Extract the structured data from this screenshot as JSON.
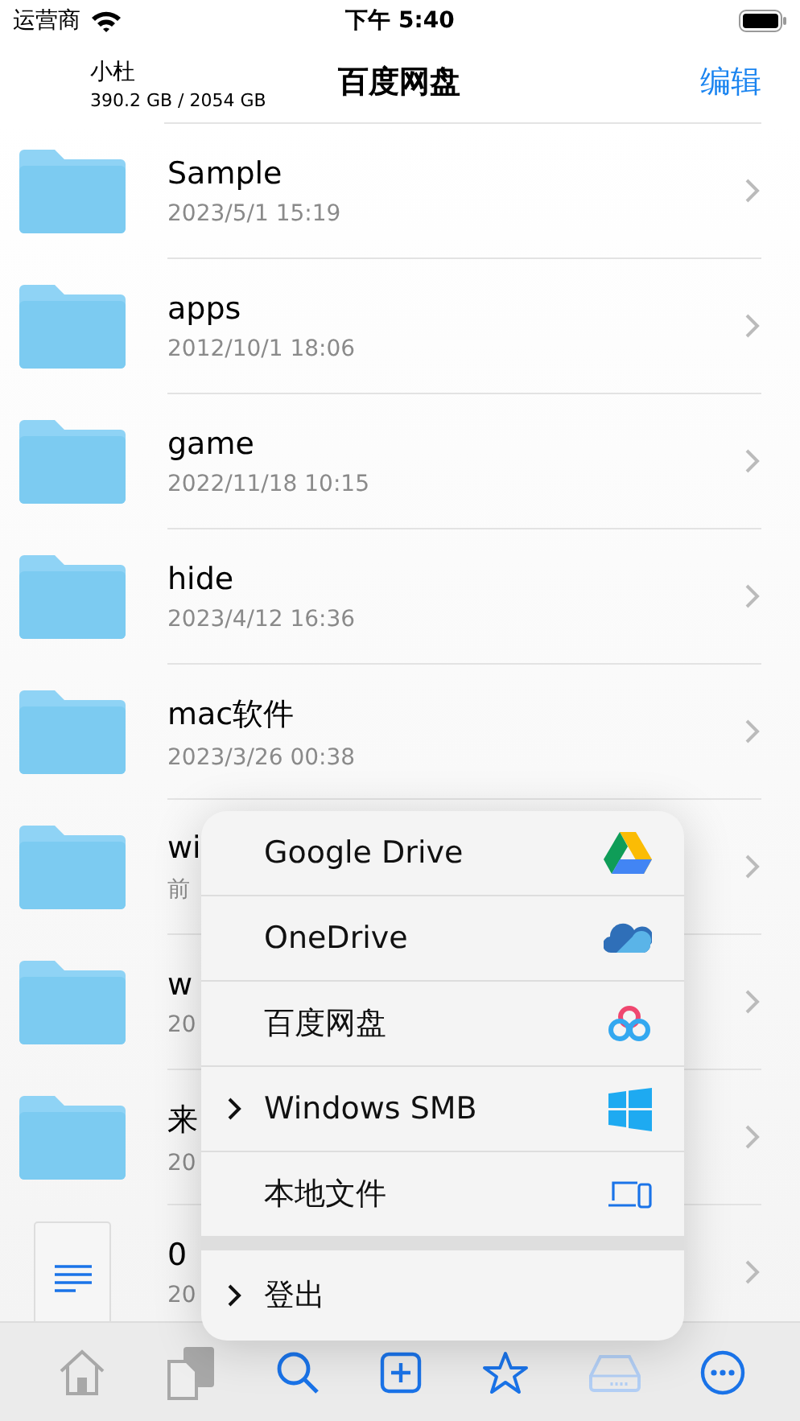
{
  "status_bar": {
    "carrier": "运营商",
    "time": "下午 5:40"
  },
  "header": {
    "user": "小杜",
    "storage": "390.2 GB / 2054 GB",
    "title": "百度网盘",
    "edit": "编辑"
  },
  "files": [
    {
      "kind": "folder",
      "name": "Sample",
      "date": "2023/5/1 15:19"
    },
    {
      "kind": "folder",
      "name": "apps",
      "date": "2012/10/1 18:06"
    },
    {
      "kind": "folder",
      "name": "game",
      "date": "2022/11/18 10:15"
    },
    {
      "kind": "folder",
      "name": "hide",
      "date": "2023/4/12 16:36"
    },
    {
      "kind": "folder",
      "name": "mac软件",
      "date": "2023/3/26 00:38"
    },
    {
      "kind": "folder",
      "name": "wi",
      "date": "前"
    },
    {
      "kind": "folder",
      "name": "w",
      "date": "20"
    },
    {
      "kind": "folder",
      "name": "来",
      "date": "20"
    },
    {
      "kind": "document",
      "name": "0",
      "date": "20"
    }
  ],
  "menu": {
    "items": [
      {
        "label": "Google Drive",
        "has_submenu": false
      },
      {
        "label": "OneDrive",
        "has_submenu": false
      },
      {
        "label": "百度网盘",
        "has_submenu": false
      },
      {
        "label": "Windows SMB",
        "has_submenu": true
      },
      {
        "label": "本地文件",
        "has_submenu": false
      }
    ],
    "footer_item": {
      "label": "登出",
      "has_submenu": true
    }
  },
  "toolbar": [
    {
      "disabled": true,
      "dimmed": false
    },
    {
      "disabled": true,
      "dimmed": false
    },
    {
      "disabled": false,
      "dimmed": false
    },
    {
      "disabled": false,
      "dimmed": false
    },
    {
      "disabled": false,
      "dimmed": false
    },
    {
      "disabled": false,
      "dimmed": true
    },
    {
      "disabled": false,
      "dimmed": false
    }
  ]
}
